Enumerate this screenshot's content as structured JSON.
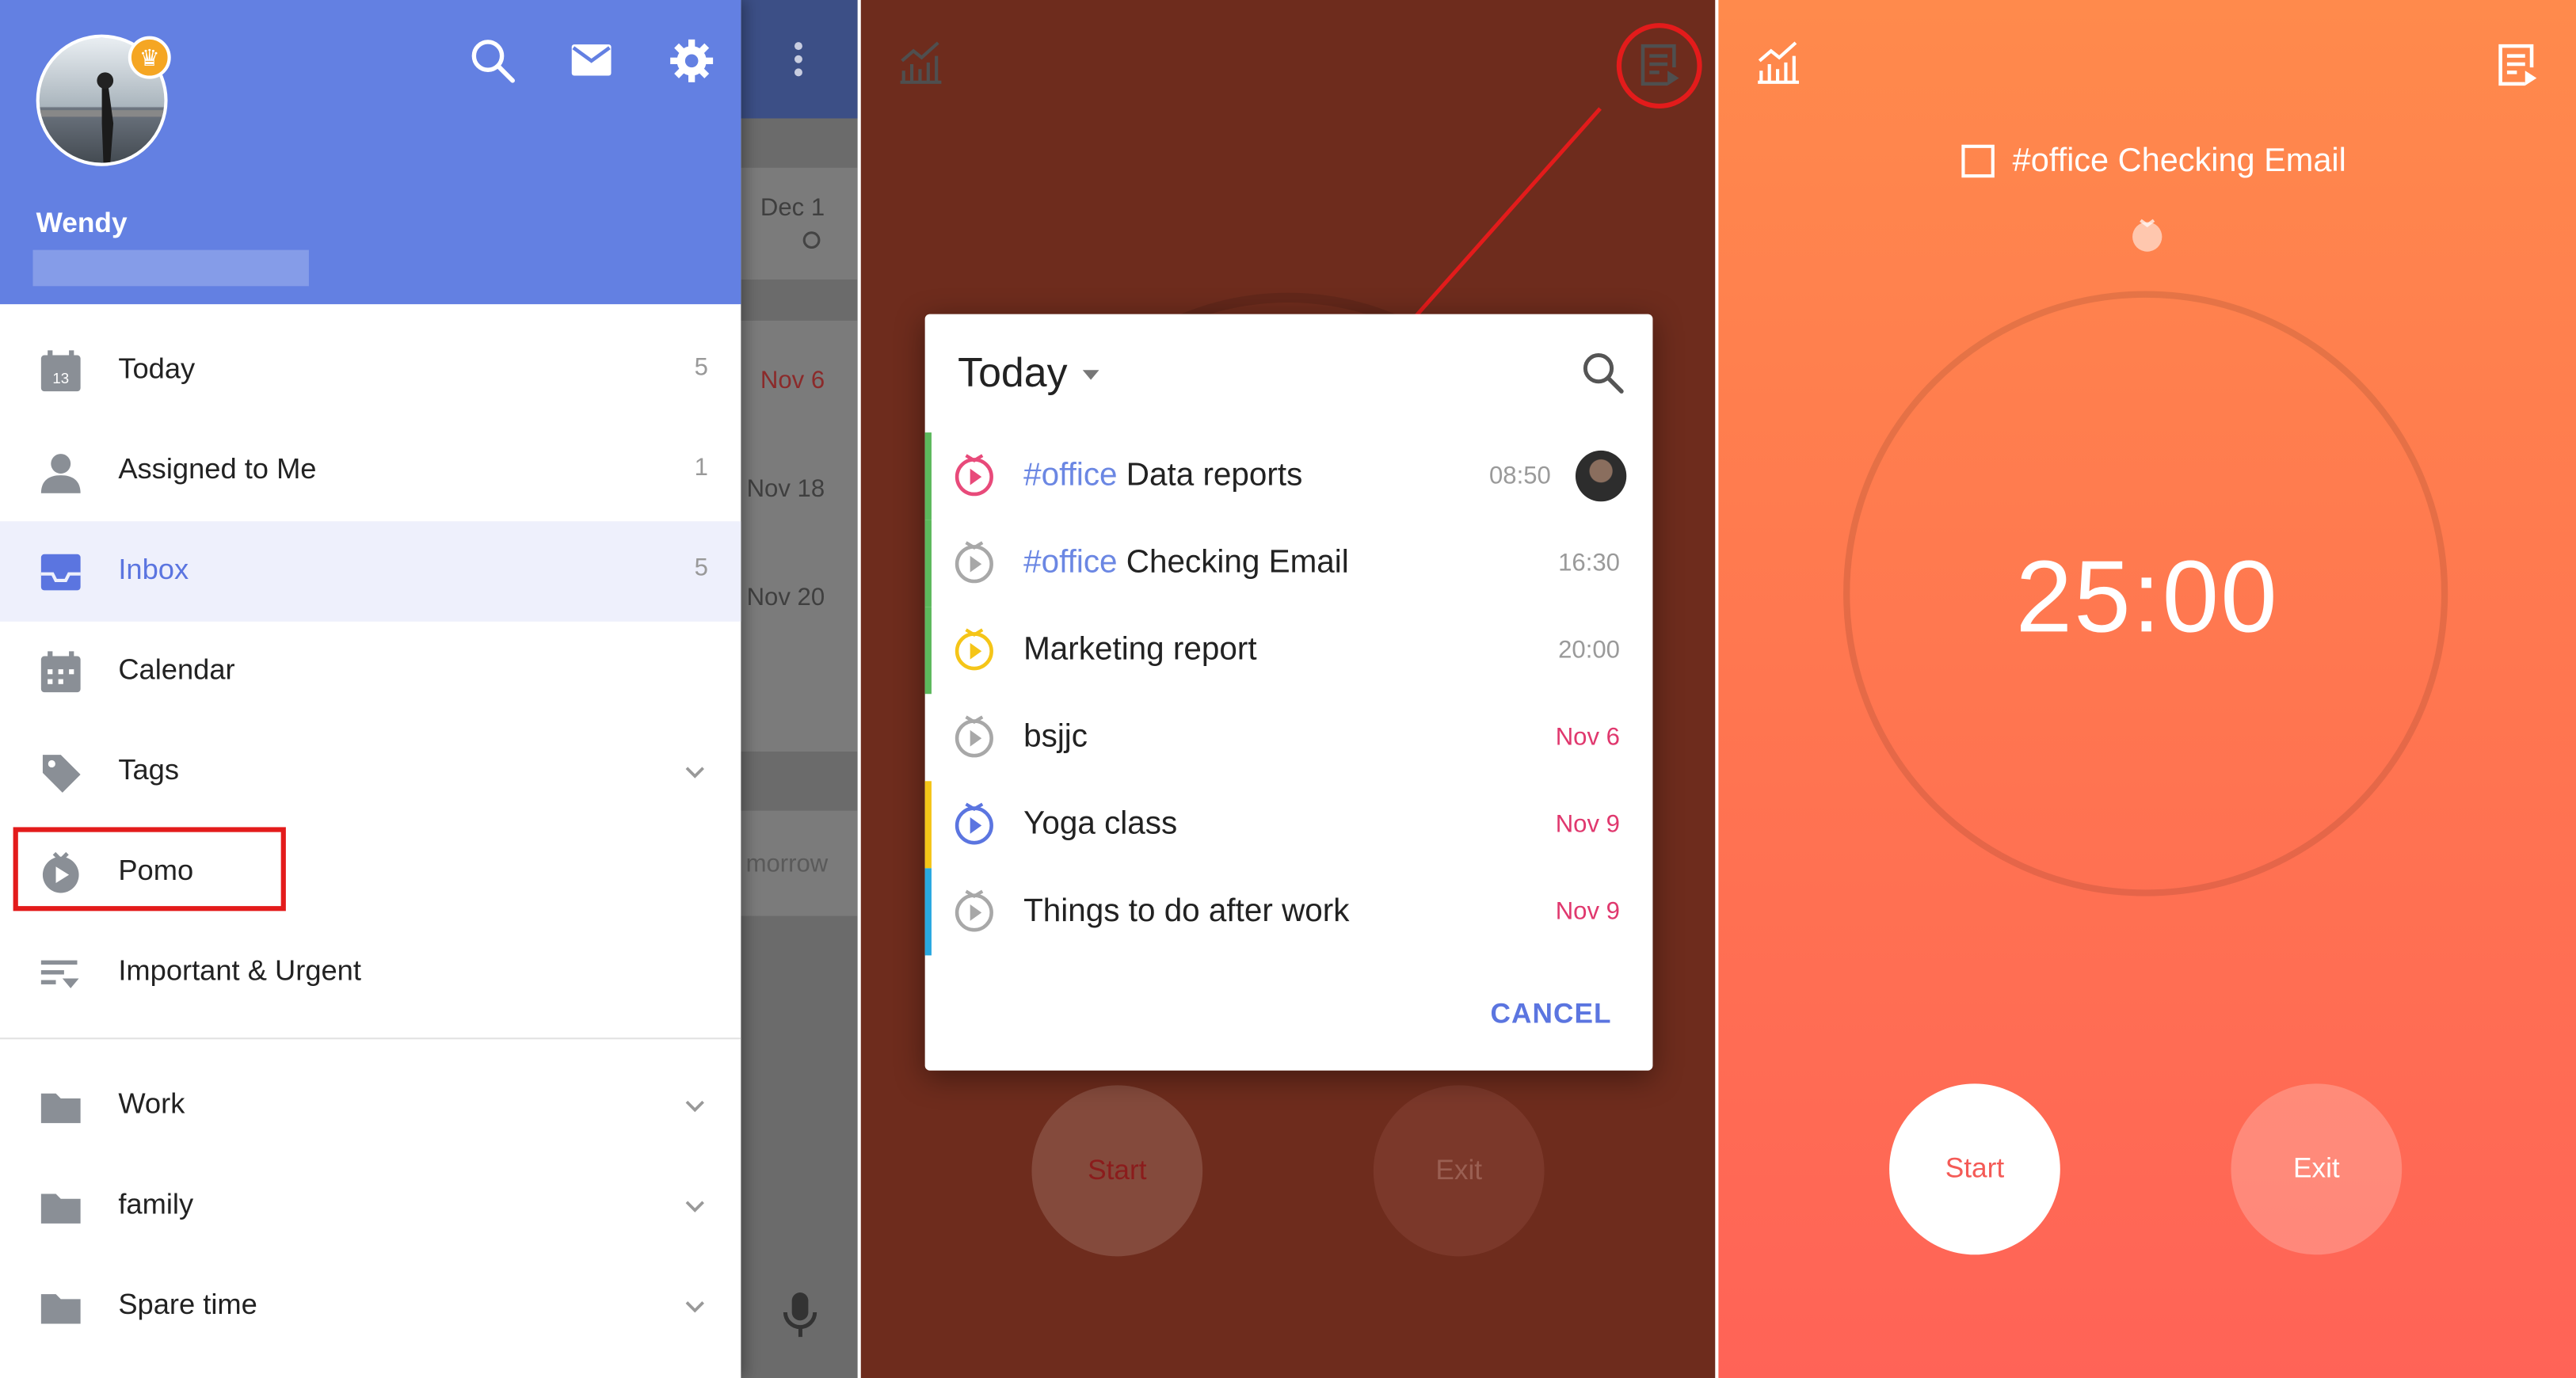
{
  "drawer": {
    "user_name": "Wendy",
    "menu": [
      {
        "label": "Today",
        "count": "5",
        "icon": "calendar-day-icon"
      },
      {
        "label": "Assigned to Me",
        "count": "1",
        "icon": "person-icon"
      },
      {
        "label": "Inbox",
        "count": "5",
        "icon": "inbox-icon",
        "active": true
      },
      {
        "label": "Calendar",
        "icon": "calendar-grid-icon"
      },
      {
        "label": "Tags",
        "icon": "tag-icon"
      },
      {
        "label": "Pomo",
        "icon": "pomo-timer-icon"
      },
      {
        "label": "Important & Urgent",
        "icon": "filter-list-icon"
      }
    ],
    "lists": [
      {
        "label": "Work",
        "icon": "folder-icon"
      },
      {
        "label": "family",
        "icon": "folder-icon"
      },
      {
        "label": "Spare time",
        "icon": "folder-icon"
      }
    ],
    "today_icon_day": "13",
    "accent": "#6380e2"
  },
  "background_app": {
    "dates": [
      "Dec 1",
      "Nov 6",
      "Nov 18",
      "Nov 20"
    ],
    "partial_text": "morrow"
  },
  "dialog": {
    "title": "Today",
    "tasks": [
      {
        "tag": "#office",
        "title": "Data reports",
        "time": "08:50",
        "bar": "#5cb85c",
        "icon_color": "#e84a7a"
      },
      {
        "tag": "#office",
        "title": "Checking Email",
        "time": "16:30",
        "bar": "#5cb85c",
        "icon_color": "#a8a8a8"
      },
      {
        "tag": "",
        "title": "Marketing report",
        "time": "20:00",
        "bar": "#5cb85c",
        "icon_color": "#f5c518"
      },
      {
        "tag": "",
        "title": "bsjjc",
        "time": "Nov 6",
        "bar": "",
        "icon_color": "#a8a8a8",
        "overdue": true
      },
      {
        "tag": "",
        "title": "Yoga class",
        "time": "Nov 9",
        "bar": "#f5c518",
        "icon_color": "#5b75e0",
        "overdue": true
      },
      {
        "tag": "",
        "title": "Things to do after work",
        "time": "Nov 9",
        "bar": "#29a8e0",
        "icon_color": "#a8a8a8",
        "overdue": true
      }
    ],
    "cancel_label": "CANCEL"
  },
  "pomo_dim": {
    "start_label": "Start",
    "exit_label": "Exit"
  },
  "pomo": {
    "task_tag": "#office",
    "task_title": "Checking Email",
    "timer": "25:00",
    "start_label": "Start",
    "exit_label": "Exit"
  }
}
